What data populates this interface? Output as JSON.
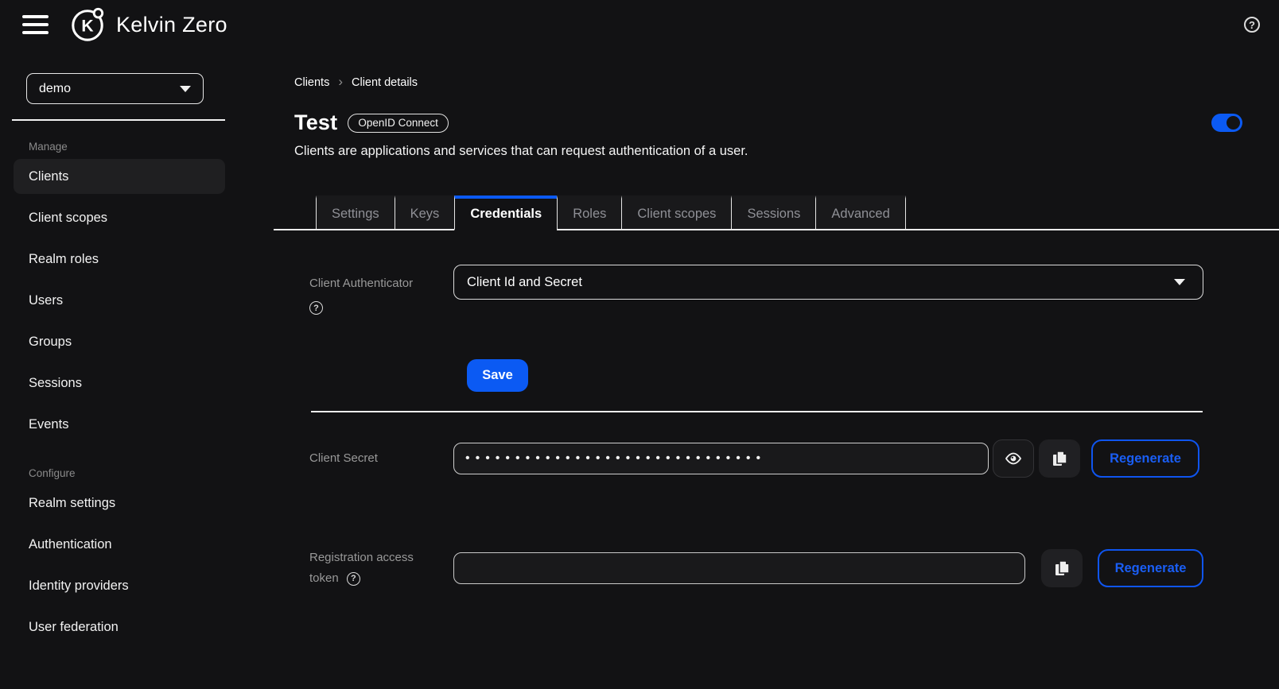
{
  "topbar": {
    "brand": "Kelvin Zero",
    "help_icon": "?"
  },
  "sidebar": {
    "realm_selector": {
      "value": "demo"
    },
    "sections": [
      {
        "label": "Manage",
        "items": [
          {
            "label": "Clients",
            "active": true
          },
          {
            "label": "Client scopes"
          },
          {
            "label": "Realm roles"
          },
          {
            "label": "Users"
          },
          {
            "label": "Groups"
          },
          {
            "label": "Sessions"
          },
          {
            "label": "Events"
          }
        ]
      },
      {
        "label": "Configure",
        "items": [
          {
            "label": "Realm settings"
          },
          {
            "label": "Authentication"
          },
          {
            "label": "Identity providers"
          },
          {
            "label": "User federation"
          }
        ]
      }
    ]
  },
  "main": {
    "breadcrumb": {
      "parent": "Clients",
      "current": "Client details"
    },
    "header": {
      "title": "Test",
      "badge": "OpenID Connect",
      "description": "Clients are applications and services that can request authentication of a user.",
      "enabled_toggle": "on"
    },
    "tabs": [
      {
        "label": "Settings"
      },
      {
        "label": "Keys"
      },
      {
        "label": "Credentials",
        "active": true
      },
      {
        "label": "Roles"
      },
      {
        "label": "Client scopes"
      },
      {
        "label": "Sessions"
      },
      {
        "label": "Advanced"
      }
    ],
    "form": {
      "client_authenticator": {
        "label": "Client Authenticator",
        "value": "Client Id and Secret"
      },
      "save_button": "Save",
      "client_secret": {
        "label": "Client Secret",
        "masked_value": "••••••••••••••••••••••••••••••",
        "regenerate_button": "Regenerate"
      },
      "registration_token": {
        "label_line1": "Registration access",
        "label_line2": "token",
        "value": "",
        "regenerate_button": "Regenerate"
      }
    }
  },
  "colors": {
    "accent_blue": "#0b5af3",
    "background": "#121214",
    "muted_text": "#8b8b8b"
  }
}
